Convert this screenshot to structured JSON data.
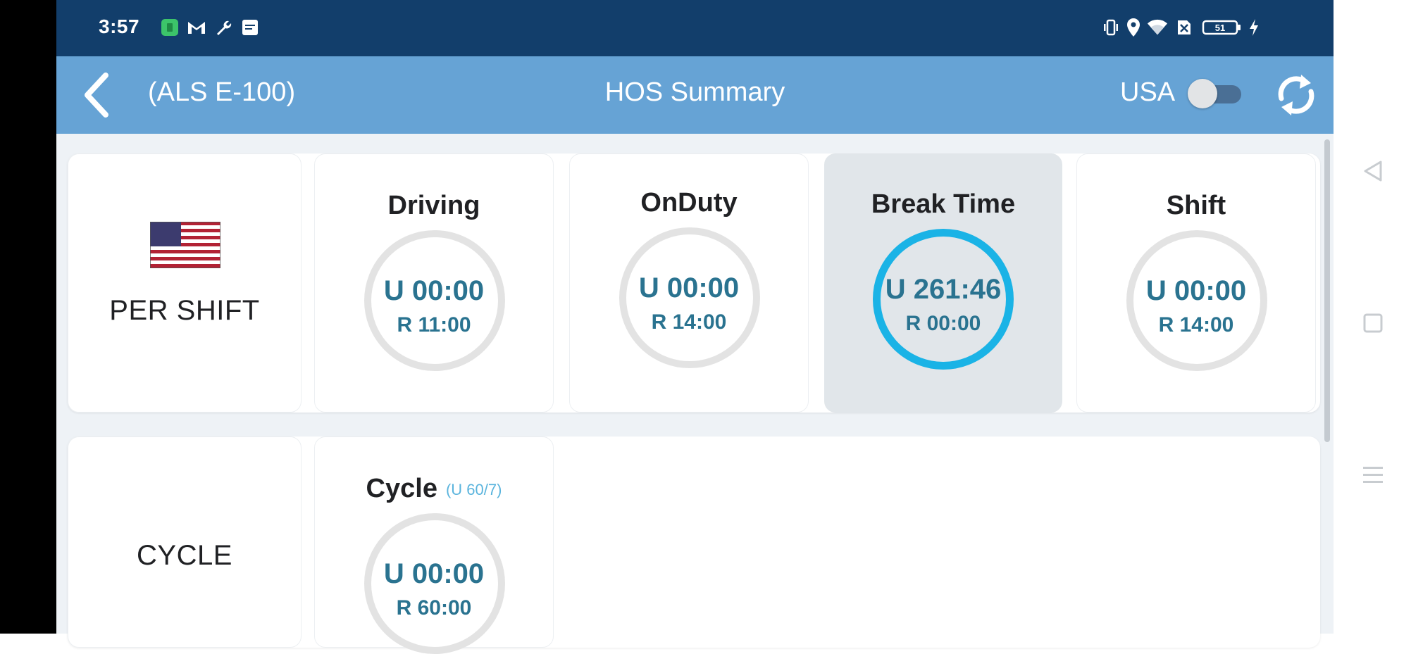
{
  "status_bar": {
    "time": "3:57",
    "battery": "51"
  },
  "app_bar": {
    "vehicle_id": "(ALS E-100)",
    "title": "HOS Summary",
    "region_label": "USA"
  },
  "per_shift": {
    "label": "PER SHIFT",
    "cards": [
      {
        "title": "Driving",
        "used": "U 00:00",
        "remaining": "R 11:00"
      },
      {
        "title": "OnDuty",
        "used": "U 00:00",
        "remaining": "R 14:00"
      },
      {
        "title": "Break Time",
        "used": "U 261:46",
        "remaining": "R 00:00"
      },
      {
        "title": "Shift",
        "used": "U 00:00",
        "remaining": "R 14:00"
      }
    ]
  },
  "cycle": {
    "label": "CYCLE",
    "title": "Cycle",
    "rule": "(U 60/7)",
    "used": "U 00:00",
    "remaining": "R 60:00"
  },
  "colors": {
    "status_bar": "#123e6b",
    "app_bar": "#66a3d5",
    "value_text": "#2a7390",
    "active_ring": "#1ab3e6",
    "inactive_ring": "#e3e3e3"
  },
  "icons": [
    "notification-app-icon",
    "gmail-icon",
    "wrench-icon",
    "message-icon",
    "vibrate-icon",
    "location-icon",
    "wifi-icon",
    "no-sim-icon",
    "battery-icon",
    "charging-icon",
    "back-arrow-icon",
    "refresh-icon",
    "us-flag-icon",
    "nav-back-icon",
    "nav-home-icon",
    "nav-recents-icon"
  ]
}
